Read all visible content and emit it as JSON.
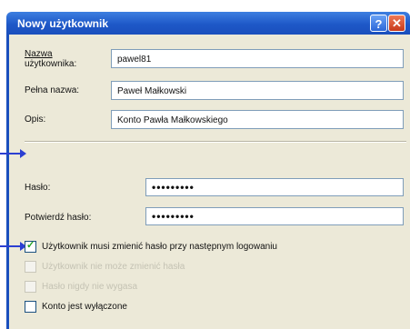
{
  "window": {
    "title": "Nowy użytkownik",
    "help_glyph": "?",
    "close_glyph": "✕"
  },
  "form": {
    "username": {
      "label_line1": "Nazwa",
      "label_line2": "użytkownika:",
      "value": "pawel81"
    },
    "fullname": {
      "label": "Pełna nazwa:",
      "value": "Paweł Małkowski"
    },
    "description": {
      "label": "Opis:",
      "value": "Konto Pawła Małkowskiego"
    },
    "password": {
      "label": "Hasło:",
      "value": "•••••••••"
    },
    "confirm": {
      "label": "Potwierdź hasło:",
      "value": "•••••••••"
    }
  },
  "options": [
    {
      "label": "Użytkownik musi zmienić hasło przy następnym logowaniu",
      "checked": true,
      "disabled": false
    },
    {
      "label": "Użytkownik nie może zmienić hasła",
      "checked": false,
      "disabled": true
    },
    {
      "label": "Hasło nigdy nie wygasa",
      "checked": false,
      "disabled": true
    },
    {
      "label": "Konto jest wyłączone",
      "checked": false,
      "disabled": false
    }
  ],
  "colors": {
    "titlebar": "#1e58c8",
    "dialog_bg": "#ece9d8",
    "arrow": "#2b3fd2",
    "check": "#21a121"
  }
}
